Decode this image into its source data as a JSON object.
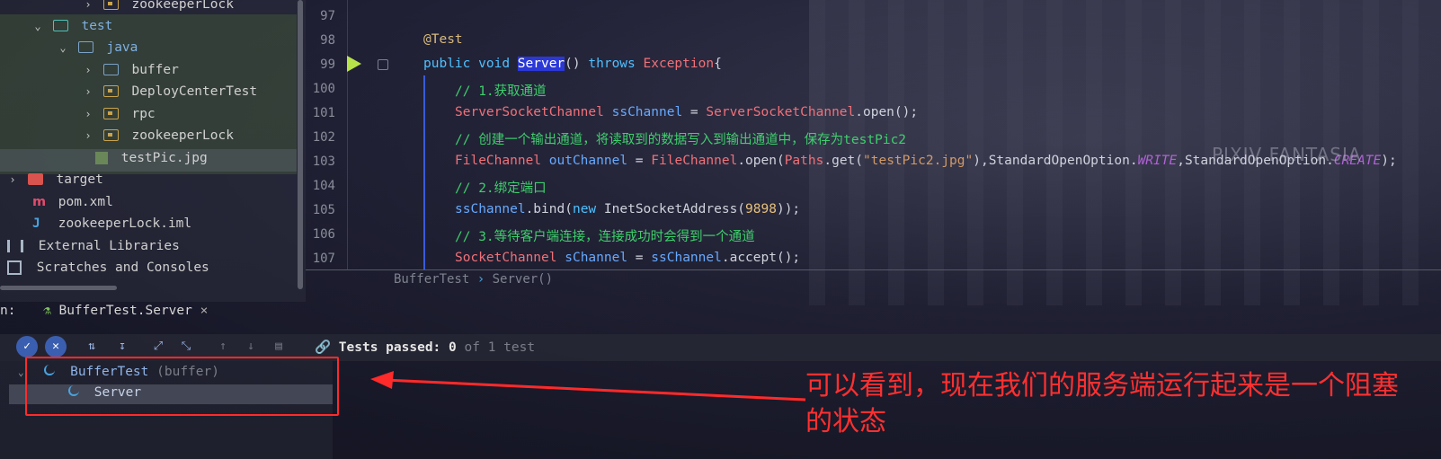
{
  "project_tree": {
    "items": [
      {
        "label": "zookeeperLock",
        "chevron": "›",
        "icon": "folder-package"
      },
      {
        "label": "test",
        "chevron": "⌄",
        "icon": "folder-test"
      },
      {
        "label": "java",
        "chevron": "⌄",
        "icon": "folder"
      },
      {
        "label": "buffer",
        "chevron": "›",
        "icon": "folder"
      },
      {
        "label": "DeployCenterTest",
        "chevron": "›",
        "icon": "folder-package"
      },
      {
        "label": "rpc",
        "chevron": "›",
        "icon": "folder-package"
      },
      {
        "label": "zookeeperLock",
        "chevron": "›",
        "icon": "folder-package"
      },
      {
        "label": "testPic.jpg",
        "chevron": "",
        "icon": "image-file"
      },
      {
        "label": "target",
        "chevron": "›",
        "icon": "folder-excluded"
      },
      {
        "label": "pom.xml",
        "chevron": "",
        "icon": "maven"
      },
      {
        "label": "zookeeperLock.iml",
        "chevron": "",
        "icon": "iml-file"
      },
      {
        "label": "External Libraries",
        "chevron": "",
        "icon": "library"
      },
      {
        "label": "Scratches and Consoles",
        "chevron": "",
        "icon": "scratches"
      }
    ]
  },
  "editor": {
    "line_numbers": [
      "97",
      "98",
      "99",
      "100",
      "101",
      "102",
      "103",
      "104",
      "105",
      "106",
      "107"
    ],
    "lines": {
      "l98_annotation": "@Test",
      "l99_public": "public",
      "l99_void": "void",
      "l99_name": "Server",
      "l99_parens": "()",
      "l99_throws": "throws",
      "l99_exc": "Exception",
      "l99_brace": "{",
      "l100": "// 1.获取通道",
      "l101_type": "ServerSocketChannel",
      "l101_var": "ssChannel",
      "l101_eq": " = ",
      "l101_type2": "ServerSocketChannel",
      "l101_rest": ".open();",
      "l102": "// 创建一个输出通道，将读取到的数据写入到输出通道中，保存为testPic2",
      "l103_type": "FileChannel",
      "l103_var": "outChannel",
      "l103_eq": " = ",
      "l103_type2": "FileChannel",
      "l103_open": ".open(",
      "l103_paths": "Paths",
      "l103_get": ".get(",
      "l103_str": "\"testPic2.jpg\"",
      "l103_mid": "),StandardOpenOption.",
      "l103_write": "WRITE",
      "l103_mid2": ",StandardOpenOption.",
      "l103_create": "CREATE",
      "l103_end": ");",
      "l104": "// 2.绑定端口",
      "l105_var": "ssChannel",
      "l105_bind": ".bind(",
      "l105_new": "new",
      "l105_type": " InetSocketAddress(",
      "l105_num": "9898",
      "l105_end": "));",
      "l106": "// 3.等待客户端连接，连接成功时会得到一个通道",
      "l107_type": "SocketChannel",
      "l107_var": "sChannel",
      "l107_eq": " = ",
      "l107_var2": "ssChannel",
      "l107_end": ".accept();"
    },
    "watermark": "PIXIV FANTASIA",
    "breadcrumb": {
      "class": "BufferTest",
      "sep": "›",
      "method": "Server()"
    }
  },
  "run_panel": {
    "label": "n:",
    "tab_title": "BufferTest.Server",
    "tab_close": "×",
    "status_label": "Tests passed:",
    "status_passed": "0",
    "status_rest": "of 1 test",
    "tree": {
      "root": "BufferTest",
      "root_pkg": "(buffer)",
      "child": "Server"
    }
  },
  "annotation": {
    "text": "可以看到，现在我们的服务端运行起来是一个阻塞的状态",
    "color": "#ff3030"
  },
  "colors": {
    "keyword": "#4fc1ff",
    "comment": "#3ecf6c",
    "type": "#f07178",
    "highlight": "#2b38d6",
    "red_box": "#ff2a2a"
  }
}
